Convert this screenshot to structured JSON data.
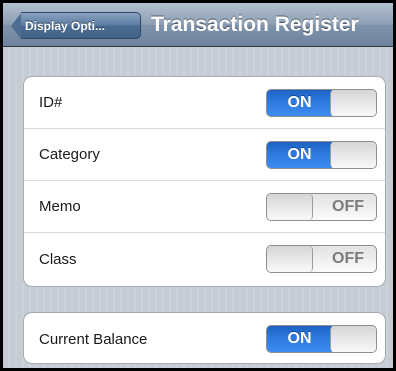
{
  "navbar": {
    "back_label": "Display Opti...",
    "title": "Transaction Register"
  },
  "columns_group": {
    "rows": [
      {
        "label": "ID#",
        "toggle_state": "ON",
        "on": true
      },
      {
        "label": "Category",
        "toggle_state": "ON",
        "on": true
      },
      {
        "label": "Memo",
        "toggle_state": "OFF",
        "on": false
      },
      {
        "label": "Class",
        "toggle_state": "OFF",
        "on": false
      }
    ]
  },
  "balance_group": {
    "rows": [
      {
        "label": "Current Balance",
        "toggle_state": "ON",
        "on": true
      }
    ]
  },
  "colors": {
    "toggle_on_blue": "#2e7ae0",
    "navbar": "#8d9fb5",
    "background_stripes": "#c5ccd4"
  }
}
